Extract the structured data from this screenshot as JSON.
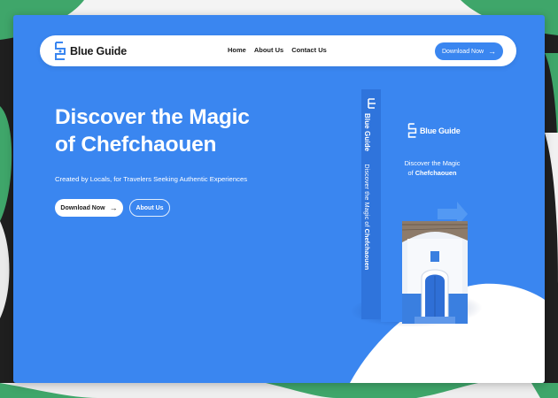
{
  "brand": {
    "name": "Blue Guide",
    "primary_color": "#3a86f0",
    "accent_green": "#3fa66a",
    "dark_backdrop": "#1f1f1f"
  },
  "navbar": {
    "logo_text": "Blue Guide",
    "links": [
      "Home",
      "About Us",
      "Contact Us"
    ],
    "cta_label": "Download Now",
    "cta_icon": "arrow-right-icon"
  },
  "hero": {
    "title_line1": "Discover the Magic",
    "title_line2": "of Chefchaouen",
    "subtitle": "Created by Locals, for Travelers Seeking Authentic Experiences",
    "primary_button": "Download Now",
    "primary_button_icon": "arrow-right-icon",
    "secondary_button": "About Us"
  },
  "book": {
    "spine_brand": "Blue Guide",
    "spine_title_prefix": "Discover the Magic of",
    "spine_title_place": "Chefchaouen",
    "cover_brand": "Blue Guide",
    "cover_title_line1": "Discover the Magic",
    "cover_title_prefix": "of",
    "cover_title_place": "Chefchaouen"
  }
}
